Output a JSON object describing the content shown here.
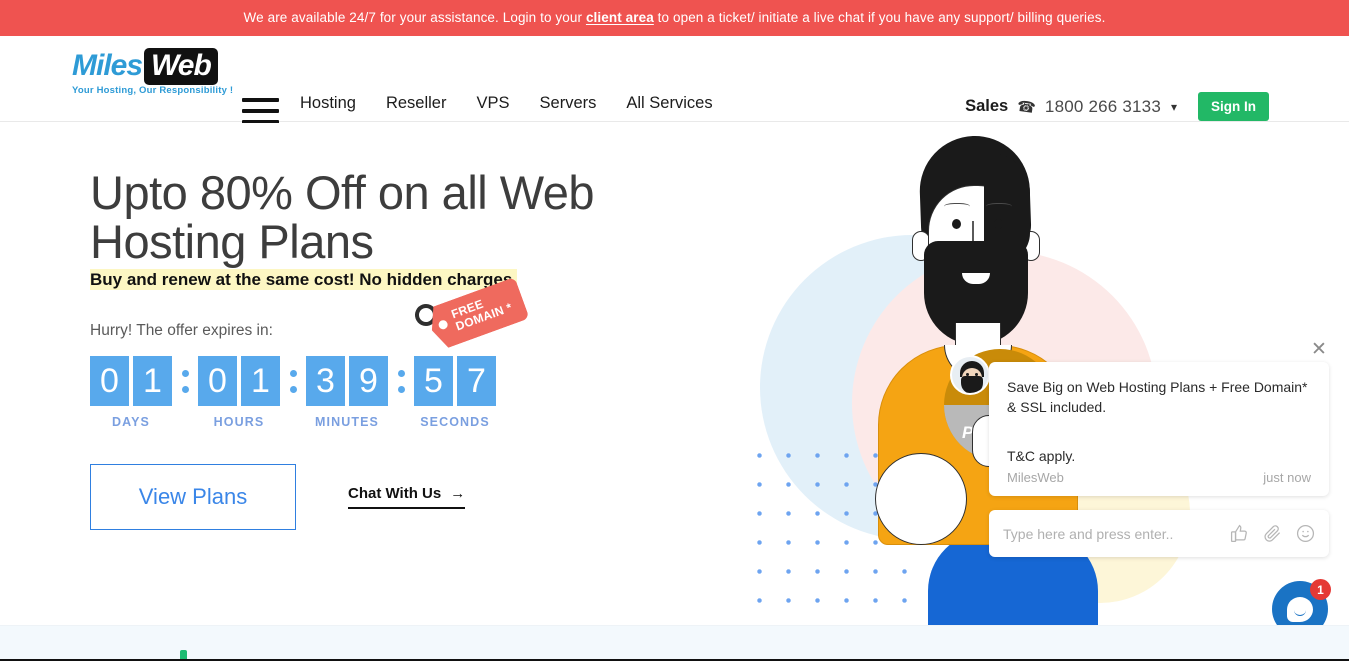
{
  "announcement": {
    "text_before": "We are available 24/7 for your assistance. Login to your ",
    "link": "client area",
    "text_after": " to open a ticket/ initiate a live chat if you have any support/ billing queries.",
    "bg_color": "#ef5350"
  },
  "header": {
    "logo": {
      "part1": "Miles",
      "part2": "Web",
      "tagline": "Your Hosting, Our Responsibility !"
    },
    "menu_icon": "hamburger-icon",
    "nav": [
      {
        "label": "Hosting"
      },
      {
        "label": "Reseller"
      },
      {
        "label": "VPS"
      },
      {
        "label": "Servers"
      },
      {
        "label": "All Services"
      }
    ],
    "sales_label": "Sales",
    "phone_icon": "phone-icon",
    "phone": "1800 266 3133",
    "caret": "⌄",
    "signin": "Sign In",
    "signin_color": "#22b866"
  },
  "hero": {
    "title_line1": "Upto 80% Off on all Web",
    "title_line2": "Hosting Plans",
    "tag_line1": "FREE",
    "tag_line2": "DOMAIN *",
    "tag_color": "#ef6a5e",
    "subtitle": "Buy and renew at the same cost! No hidden charges.",
    "highlight_color": "#fdf7c3",
    "hurry": "Hurry! The offer expires in:",
    "countdown": {
      "tile_color": "#58a9ec",
      "groups": [
        {
          "label": "DAYS",
          "digits": [
            "0",
            "1"
          ]
        },
        {
          "label": "HOURS",
          "digits": [
            "0",
            "1"
          ]
        },
        {
          "label": "MINUTES",
          "digits": [
            "3",
            "9"
          ]
        },
        {
          "label": "SECONDS",
          "digits": [
            "5",
            "7"
          ]
        }
      ],
      "separator": ":"
    },
    "view_plans": "View Plans",
    "chat_with_us": "Chat With Us",
    "chat_arrow": "→"
  },
  "illustration": {
    "badge_text": "Play",
    "circle_blue": "#e2f0f9",
    "circle_pink": "#fce9e8",
    "dot_color": "#6ea4f0",
    "shirt_color": "#f5a413",
    "pants_color": "#1667d4"
  },
  "chat_widget": {
    "close_icon": "close-icon",
    "message": "Save Big on Web Hosting Plans + Free Domain* & SSL included.",
    "terms": "T&C apply.",
    "sender": "MilesWeb",
    "time": "just now",
    "input_placeholder": "Type here and press enter..",
    "icons": [
      "thumbs-up-icon",
      "paperclip-icon",
      "emoji-icon"
    ],
    "fab_badge": "1",
    "fab_color": "#1a73c4",
    "badge_color": "#e53935"
  }
}
